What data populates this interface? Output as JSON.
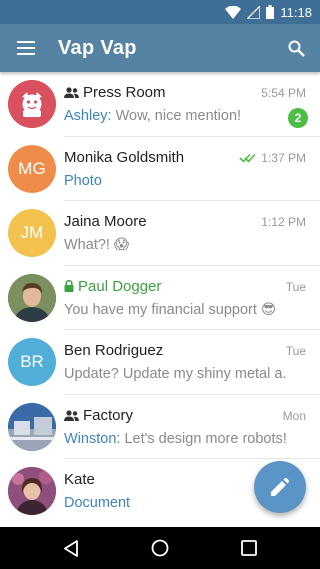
{
  "status_bar": {
    "time": "11:18"
  },
  "app_bar": {
    "title": "Vap Vap"
  },
  "chats": [
    {
      "name": "Press Room",
      "group": true,
      "time": "5:54 PM",
      "sender": "Ashley",
      "message": " Wow, nice mention!",
      "unread": "2",
      "avatar": {
        "type": "dog-logo",
        "color": "#d9515e"
      }
    },
    {
      "name": "Monika Goldsmith",
      "time": "1:37 PM",
      "read": true,
      "media": "Photo",
      "avatar": {
        "type": "initials",
        "initials": "MG",
        "color": "#ef8c4a"
      }
    },
    {
      "name": "Jaina Moore",
      "time": "1:12 PM",
      "message": "What?! 😱",
      "avatar": {
        "type": "initials",
        "initials": "JM",
        "color": "#f2c14e"
      }
    },
    {
      "name": "Paul Dogger",
      "secret": true,
      "time": "Tue",
      "message": "You have my financial support 😎",
      "avatar": {
        "type": "photo",
        "color": "#6a7d54"
      }
    },
    {
      "name": "Ben Rodriguez",
      "time": "Tue",
      "message": "Update? Update my shiny metal a...",
      "avatar": {
        "type": "initials",
        "initials": "BR",
        "color": "#50aed8"
      }
    },
    {
      "name": "Factory",
      "group": true,
      "time": "Mon",
      "sender": "Winston",
      "message": " Let's design more robots!",
      "avatar": {
        "type": "photo",
        "color": "#3a6aa8"
      }
    },
    {
      "name": "Kate",
      "time": "",
      "media": "Document",
      "avatar": {
        "type": "photo",
        "color": "#8e4f7c"
      }
    }
  ],
  "icons": {
    "wifi": "wifi-icon",
    "signal": "signal-icon",
    "battery": "battery-icon",
    "menu": "hamburger-menu-icon",
    "search": "search-icon",
    "group": "group-icon",
    "lock": "lock-icon",
    "read": "double-check-icon",
    "compose": "pencil-icon",
    "back": "back-icon",
    "home": "home-icon",
    "recents": "recents-icon"
  },
  "colors": {
    "primary": "#5682a3",
    "status": "#3f6f97",
    "accent": "#3d85b8",
    "online": "#3ba33f",
    "badge": "#4ebd45",
    "fab": "#5b95c7"
  }
}
